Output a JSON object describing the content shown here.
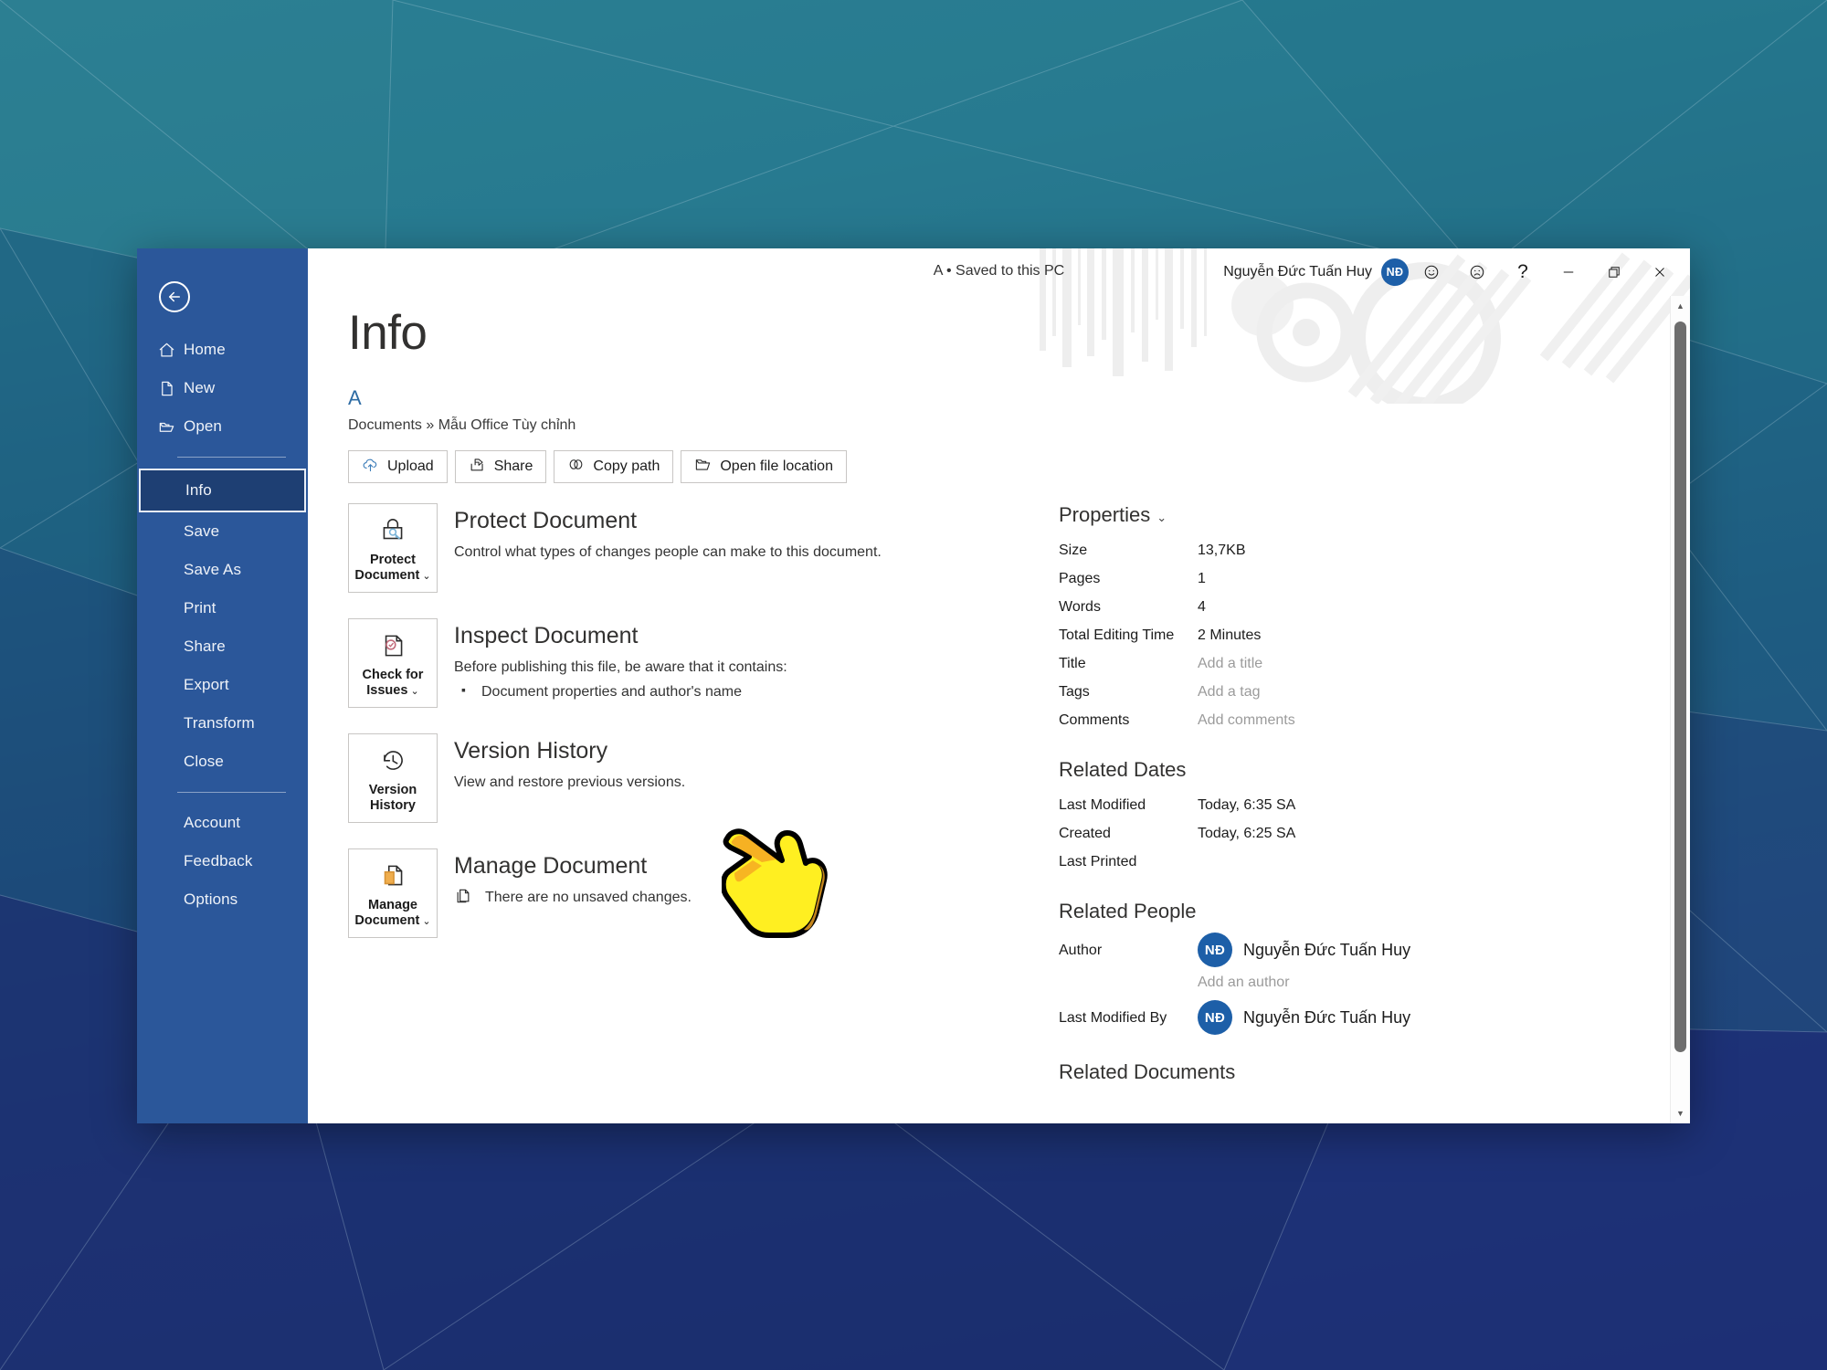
{
  "window": {
    "doc_status": "A • Saved to this PC",
    "account_name": "Nguyễn Đức Tuấn Huy",
    "avatar_initials": "NĐ",
    "controls": {
      "smile": "smile-icon",
      "frown": "frown-icon",
      "help": "?",
      "minimize": "minimize-icon",
      "restore": "restore-icon",
      "close": "close-icon"
    },
    "accent_color": "#2b579a",
    "active_item_color": "#1e3f73",
    "avatar_color": "#1d5fa8"
  },
  "sidebar": {
    "back_label": "back-arrow-icon",
    "items": [
      {
        "label": "Home",
        "icon": "home-icon",
        "active": false
      },
      {
        "label": "New",
        "icon": "page-icon",
        "active": false
      },
      {
        "label": "Open",
        "icon": "folder-icon",
        "active": false
      },
      {
        "label": "Info",
        "icon": "",
        "active": true
      },
      {
        "label": "Save",
        "icon": "",
        "active": false
      },
      {
        "label": "Save As",
        "icon": "",
        "active": false
      },
      {
        "label": "Print",
        "icon": "",
        "active": false
      },
      {
        "label": "Share",
        "icon": "",
        "active": false
      },
      {
        "label": "Export",
        "icon": "",
        "active": false
      },
      {
        "label": "Transform",
        "icon": "",
        "active": false
      },
      {
        "label": "Close",
        "icon": "",
        "active": false
      },
      {
        "label": "Account",
        "icon": "",
        "active": false
      },
      {
        "label": "Feedback",
        "icon": "",
        "active": false
      },
      {
        "label": "Options",
        "icon": "",
        "active": false
      }
    ]
  },
  "main": {
    "page_title": "Info",
    "file_name": "A",
    "breadcrumb": "Documents » Mẫu Office Tùy chỉnh",
    "toolbar": [
      {
        "label": "Upload",
        "icon": "cloud-upload-icon"
      },
      {
        "label": "Share",
        "icon": "share-icon"
      },
      {
        "label": "Copy path",
        "icon": "link-icon"
      },
      {
        "label": "Open file location",
        "icon": "folder-open-icon"
      }
    ],
    "features": [
      {
        "button_line1": "Protect",
        "button_line2": "Document",
        "has_chevron": true,
        "icon": "lock-key-icon",
        "title": "Protect Document",
        "desc": "Control what types of changes people can make to this document.",
        "bullets": []
      },
      {
        "button_line1": "Check for",
        "button_line2": "Issues",
        "has_chevron": true,
        "icon": "document-check-icon",
        "title": "Inspect Document",
        "desc": "Before publishing this file, be aware that it contains:",
        "bullets": [
          "Document properties and author's name"
        ]
      },
      {
        "button_line1": "Version",
        "button_line2": "History",
        "has_chevron": false,
        "icon": "clock-history-icon",
        "title": "Version History",
        "desc": "View and restore previous versions.",
        "bullets": []
      },
      {
        "button_line1": "Manage",
        "button_line2": "Document",
        "has_chevron": true,
        "icon": "manage-document-icon",
        "title": "Manage Document",
        "desc": "There are no unsaved changes.",
        "bullets": []
      }
    ]
  },
  "properties": {
    "heading": "Properties",
    "chevron": "⌄",
    "rows": [
      {
        "key": "Size",
        "value": "13,7KB",
        "placeholder": false
      },
      {
        "key": "Pages",
        "value": "1",
        "placeholder": false
      },
      {
        "key": "Words",
        "value": "4",
        "placeholder": false
      },
      {
        "key": "Total Editing Time",
        "value": "2 Minutes",
        "placeholder": false
      },
      {
        "key": "Title",
        "value": "Add a title",
        "placeholder": true
      },
      {
        "key": "Tags",
        "value": "Add a tag",
        "placeholder": true
      },
      {
        "key": "Comments",
        "value": "Add comments",
        "placeholder": true
      }
    ]
  },
  "related_dates": {
    "heading": "Related Dates",
    "rows": [
      {
        "key": "Last Modified",
        "value": "Today, 6:35 SA"
      },
      {
        "key": "Created",
        "value": "Today, 6:25 SA"
      },
      {
        "key": "Last Printed",
        "value": ""
      }
    ]
  },
  "related_people": {
    "heading": "Related People",
    "author_key": "Author",
    "author_name": "Nguyễn Đức Tuấn Huy",
    "author_initials": "NĐ",
    "add_author": "Add an author",
    "modified_key": "Last Modified By",
    "modified_name": "Nguyễn Đức Tuấn Huy",
    "modified_initials": "NĐ"
  },
  "related_documents": {
    "heading": "Related Documents"
  }
}
